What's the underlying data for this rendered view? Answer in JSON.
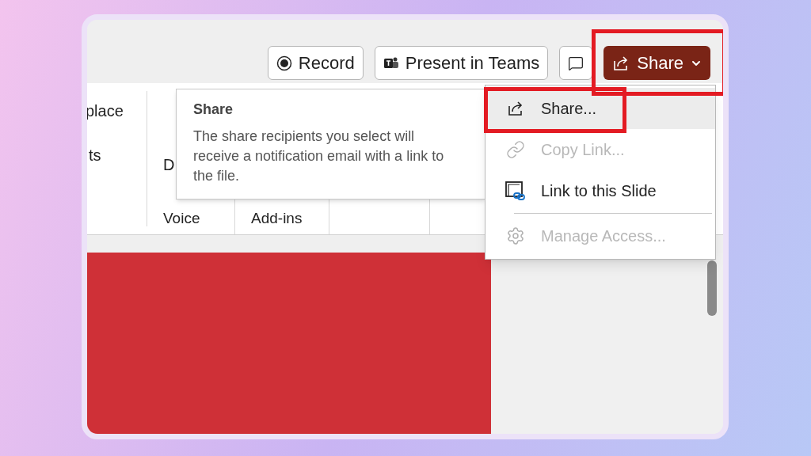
{
  "toolbar": {
    "buttons": [
      {
        "kind": "record",
        "label": "Record",
        "highlighted": false
      },
      {
        "kind": "teams",
        "label": "Present in Teams",
        "highlighted": false
      },
      {
        "kind": "comment",
        "highlighted": false
      },
      {
        "kind": "share",
        "label": "Share",
        "highlighted": true
      }
    ]
  },
  "ribbon": {
    "column_1": [
      "place",
      "ts"
    ],
    "groups": [
      {
        "content": "D",
        "label": "Voice"
      },
      {
        "label": "Add-ins"
      }
    ]
  },
  "tooltip": {
    "title": "Share",
    "body": "The share recipients you select will receive a notification email with a link to the file."
  },
  "menu": {
    "items": [
      {
        "kind": "share",
        "label": "Share...",
        "disabled": false,
        "hovered": true,
        "highlighted": true,
        "separator_before": false
      },
      {
        "kind": "copy-link",
        "label": "Copy Link...",
        "disabled": true,
        "hovered": false,
        "highlighted": false,
        "separator_before": false
      },
      {
        "kind": "slide-link",
        "label": "Link to this Slide",
        "disabled": false,
        "hovered": false,
        "highlighted": false,
        "separator_before": false
      },
      {
        "kind": "manage-access",
        "label": "Manage Access...",
        "disabled": true,
        "hovered": false,
        "highlighted": false,
        "separator_before": true
      }
    ]
  }
}
